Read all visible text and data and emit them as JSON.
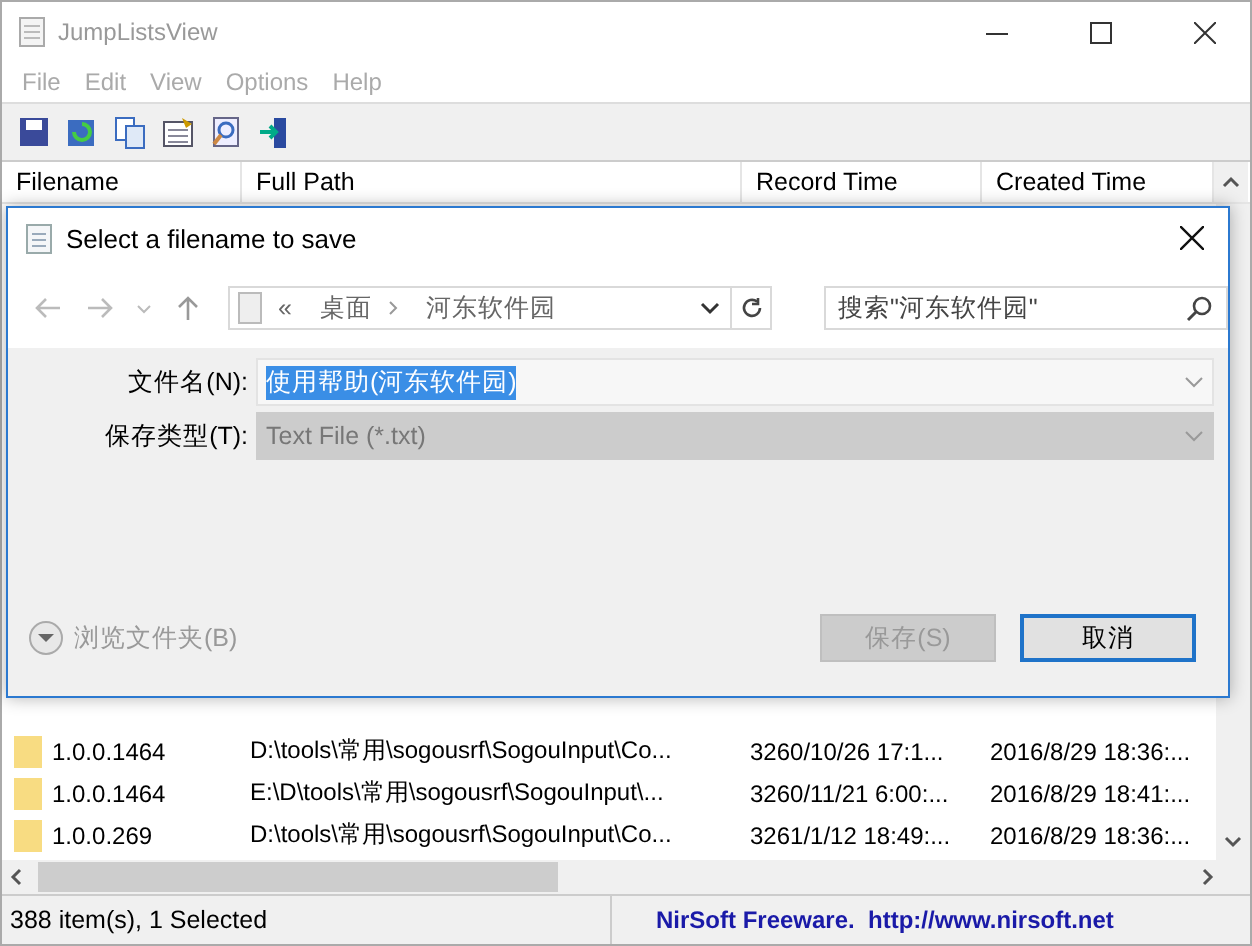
{
  "window": {
    "title": "JumpListsView"
  },
  "menu": [
    "File",
    "Edit",
    "View",
    "Options",
    "Help"
  ],
  "table": {
    "columns": [
      "Filename",
      "Full Path",
      "Record Time",
      "Created Time"
    ],
    "rows": [
      {
        "cells": [
          "1.0.0.1464",
          "D:\\tools\\常用\\sogousrf\\SogouInput\\Co...",
          "3260/10/26 17:1...",
          "2016/8/29 18:36:..."
        ]
      },
      {
        "cells": [
          "1.0.0.1464",
          "E:\\D\\tools\\常用\\sogousrf\\SogouInput\\...",
          "3260/11/21 6:00:...",
          "2016/8/29 18:41:..."
        ]
      },
      {
        "cells": [
          "1.0.0.269",
          "D:\\tools\\常用\\sogousrf\\SogouInput\\Co...",
          "3261/1/12 18:49:...",
          "2016/8/29 18:36:..."
        ]
      }
    ]
  },
  "dialog": {
    "title": "Select a filename to save",
    "path": [
      "«",
      "桌面",
      "河东软件园"
    ],
    "search": {
      "placeholder": "搜索\"河东软件园\""
    },
    "fields": [
      {
        "kind": "text",
        "label": "文件名(N):",
        "value": "使用帮助(河东软件园)",
        "disabled": false
      },
      {
        "kind": "select",
        "label": "保存类型(T):",
        "value": "Text File (*.txt)",
        "disabled": true
      }
    ],
    "browse": {
      "label": "浏览文件夹(B)",
      "expanded": false
    },
    "buttons": [
      {
        "label": "保存(S)",
        "disabled": true,
        "default": false
      },
      {
        "label": "取消",
        "disabled": false,
        "default": true
      }
    ]
  },
  "status_bar": {
    "left": "388 item(s), 1 Selected",
    "right": "NirSoft Freeware.  http://www.nirsoft.net"
  }
}
